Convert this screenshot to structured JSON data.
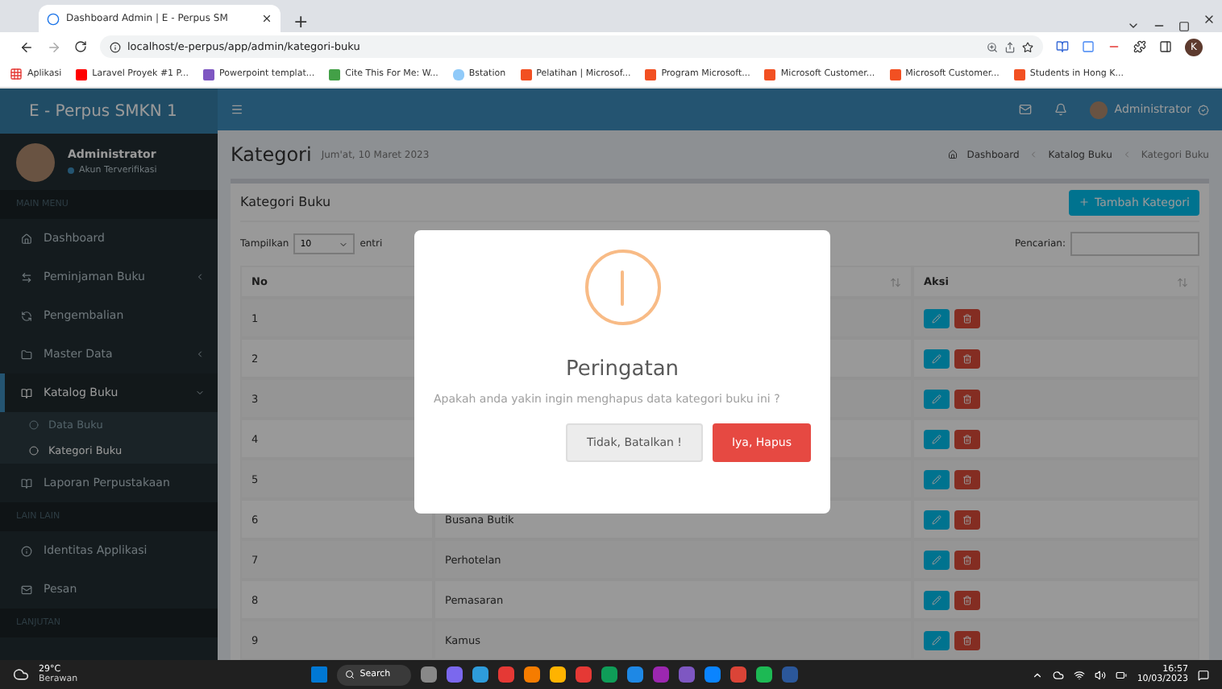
{
  "browser": {
    "tab_title": "Dashboard Admin | E - Perpus SM",
    "new_tab": "+",
    "url": "localhost/e-perpus/app/admin/kategori-buku",
    "bookmarks": [
      "Aplikasi",
      "Laravel Proyek #1 P...",
      "Powerpoint templat...",
      "Cite This For Me: W...",
      "Bstation",
      "Pelatihan | Microsof...",
      "Program Microsoft...",
      "Microsoft Customer...",
      "Microsoft Customer...",
      "Students in Hong K..."
    ],
    "profile_initial": "K"
  },
  "app": {
    "brand": "E - Perpus SMKN 1",
    "user": "Administrator"
  },
  "sidebar": {
    "user": "Administrator",
    "status": "Akun Terverifikasi",
    "sections": [
      {
        "label": "MAIN MENU",
        "items": [
          {
            "label": "Dashboard",
            "has_children": false,
            "selected": false
          },
          {
            "label": "Peminjaman Buku",
            "has_children": true,
            "expanded": false,
            "selected": false
          },
          {
            "label": "Pengembalian",
            "has_children": false,
            "selected": false
          },
          {
            "label": "Master Data",
            "has_children": true,
            "expanded": false,
            "selected": false
          },
          {
            "label": "Katalog Buku",
            "has_children": true,
            "expanded": true,
            "selected": true,
            "children": [
              {
                "label": "Data Buku",
                "selected": false
              },
              {
                "label": "Kategori Buku",
                "selected": true
              }
            ]
          },
          {
            "label": "Laporan Perpustakaan",
            "has_children": false,
            "selected": false
          }
        ]
      },
      {
        "label": "LAIN LAIN",
        "items": [
          {
            "label": "Identitas Applikasi",
            "has_children": false,
            "selected": false
          },
          {
            "label": "Pesan",
            "has_children": false,
            "selected": false
          }
        ]
      },
      {
        "label": "LANJUTAN"
      }
    ]
  },
  "page": {
    "title": "Kategori",
    "date": "Jum'at, 10 Maret 2023",
    "breadcrumb": [
      "Dashboard",
      "Katalog Buku",
      "Kategori Buku"
    ]
  },
  "card": {
    "title": "Kategori Buku",
    "add_button": "Tambah Kategori",
    "show_label": "Tampilkan",
    "show_value": "10",
    "entries_label": "entri",
    "search_label": "Pencarian:",
    "headers": {
      "no": "No",
      "actions": "Aksi"
    },
    "rows": [
      {
        "no": "1"
      },
      {
        "no": "2"
      },
      {
        "no": "3"
      },
      {
        "no": "4"
      },
      {
        "no": "5"
      },
      {
        "no": "6",
        "name": "Busana Butik"
      },
      {
        "no": "7",
        "name": "Perhotelan"
      },
      {
        "no": "8",
        "name": "Pemasaran"
      },
      {
        "no": "9",
        "name": "Kamus"
      }
    ]
  },
  "dialog": {
    "title": "Peringatan",
    "message": "Apakah anda yakin ingin menghapus data kategori buku ini ?",
    "cancel": "Tidak, Batalkan !",
    "confirm": "Iya, Hapus"
  },
  "taskbar": {
    "temperature": "29°C",
    "weather": "Berawan",
    "search": "Search",
    "time": "16:57",
    "date": "10/03/2023"
  }
}
